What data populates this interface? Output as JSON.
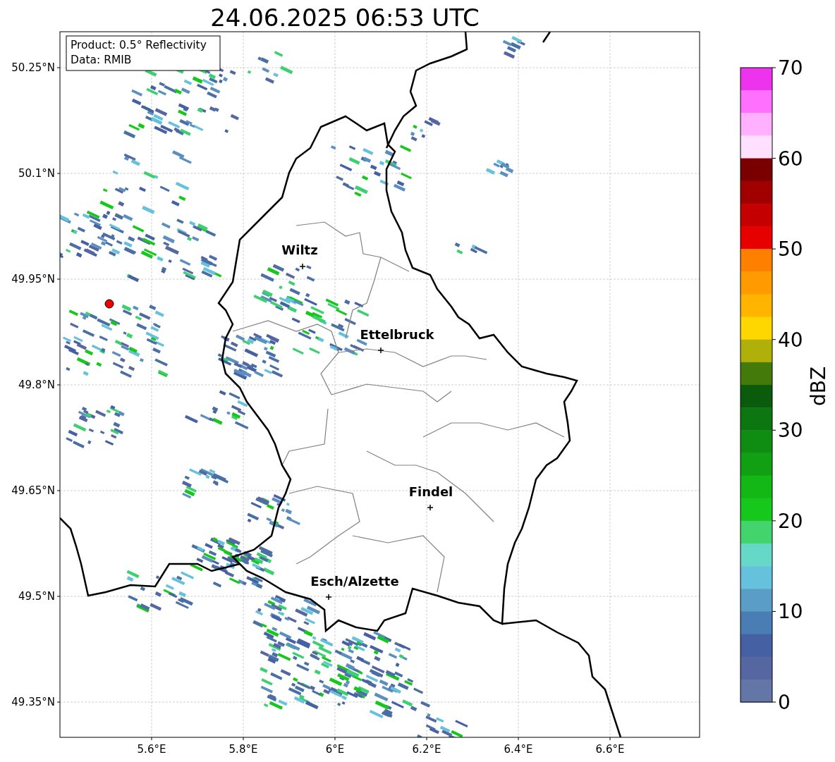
{
  "title": "24.06.2025 06:53 UTC",
  "info_box": [
    "Product: 0.5° Reflectivity",
    "Data: RMIB"
  ],
  "lat_labels": [
    "50.25°N",
    "50.1°N",
    "49.95°N",
    "49.8°N",
    "49.65°N",
    "49.5°N",
    "49.35°N"
  ],
  "lon_labels": [
    "5.6°E",
    "5.8°E",
    "6°E",
    "6.2°E",
    "6.4°E",
    "6.6°E"
  ],
  "cities": [
    {
      "name": "Wiltz"
    },
    {
      "name": "Ettelbruck"
    },
    {
      "name": "Findel"
    },
    {
      "name": "Esch/Alzette"
    }
  ],
  "colorbar": {
    "label": "dBZ",
    "ticks": [
      "70",
      "60",
      "50",
      "40",
      "30",
      "20",
      "10",
      "0"
    ],
    "segments": [
      {
        "color": "#ee33ee"
      },
      {
        "color": "#ff70ff"
      },
      {
        "color": "#ffb0ff"
      },
      {
        "color": "#ffe0ff"
      },
      {
        "color": "#7a0000"
      },
      {
        "color": "#a00000"
      },
      {
        "color": "#c40000"
      },
      {
        "color": "#e60000"
      },
      {
        "color": "#ff8000"
      },
      {
        "color": "#ff9a00"
      },
      {
        "color": "#ffb400"
      },
      {
        "color": "#ffd700"
      },
      {
        "color": "#b0b00a"
      },
      {
        "color": "#447a0a"
      },
      {
        "color": "#0a5c0c"
      },
      {
        "color": "#0c7610"
      },
      {
        "color": "#0f8c12"
      },
      {
        "color": "#11a013"
      },
      {
        "color": "#13b816"
      },
      {
        "color": "#17c81c"
      },
      {
        "color": "#44d46e"
      },
      {
        "color": "#66d8c8"
      },
      {
        "color": "#66c1dd"
      },
      {
        "color": "#5a9ec8"
      },
      {
        "color": "#4b7db5"
      },
      {
        "color": "#4661a3"
      },
      {
        "color": "#5566a0"
      },
      {
        "color": "#6475a8"
      }
    ]
  }
}
